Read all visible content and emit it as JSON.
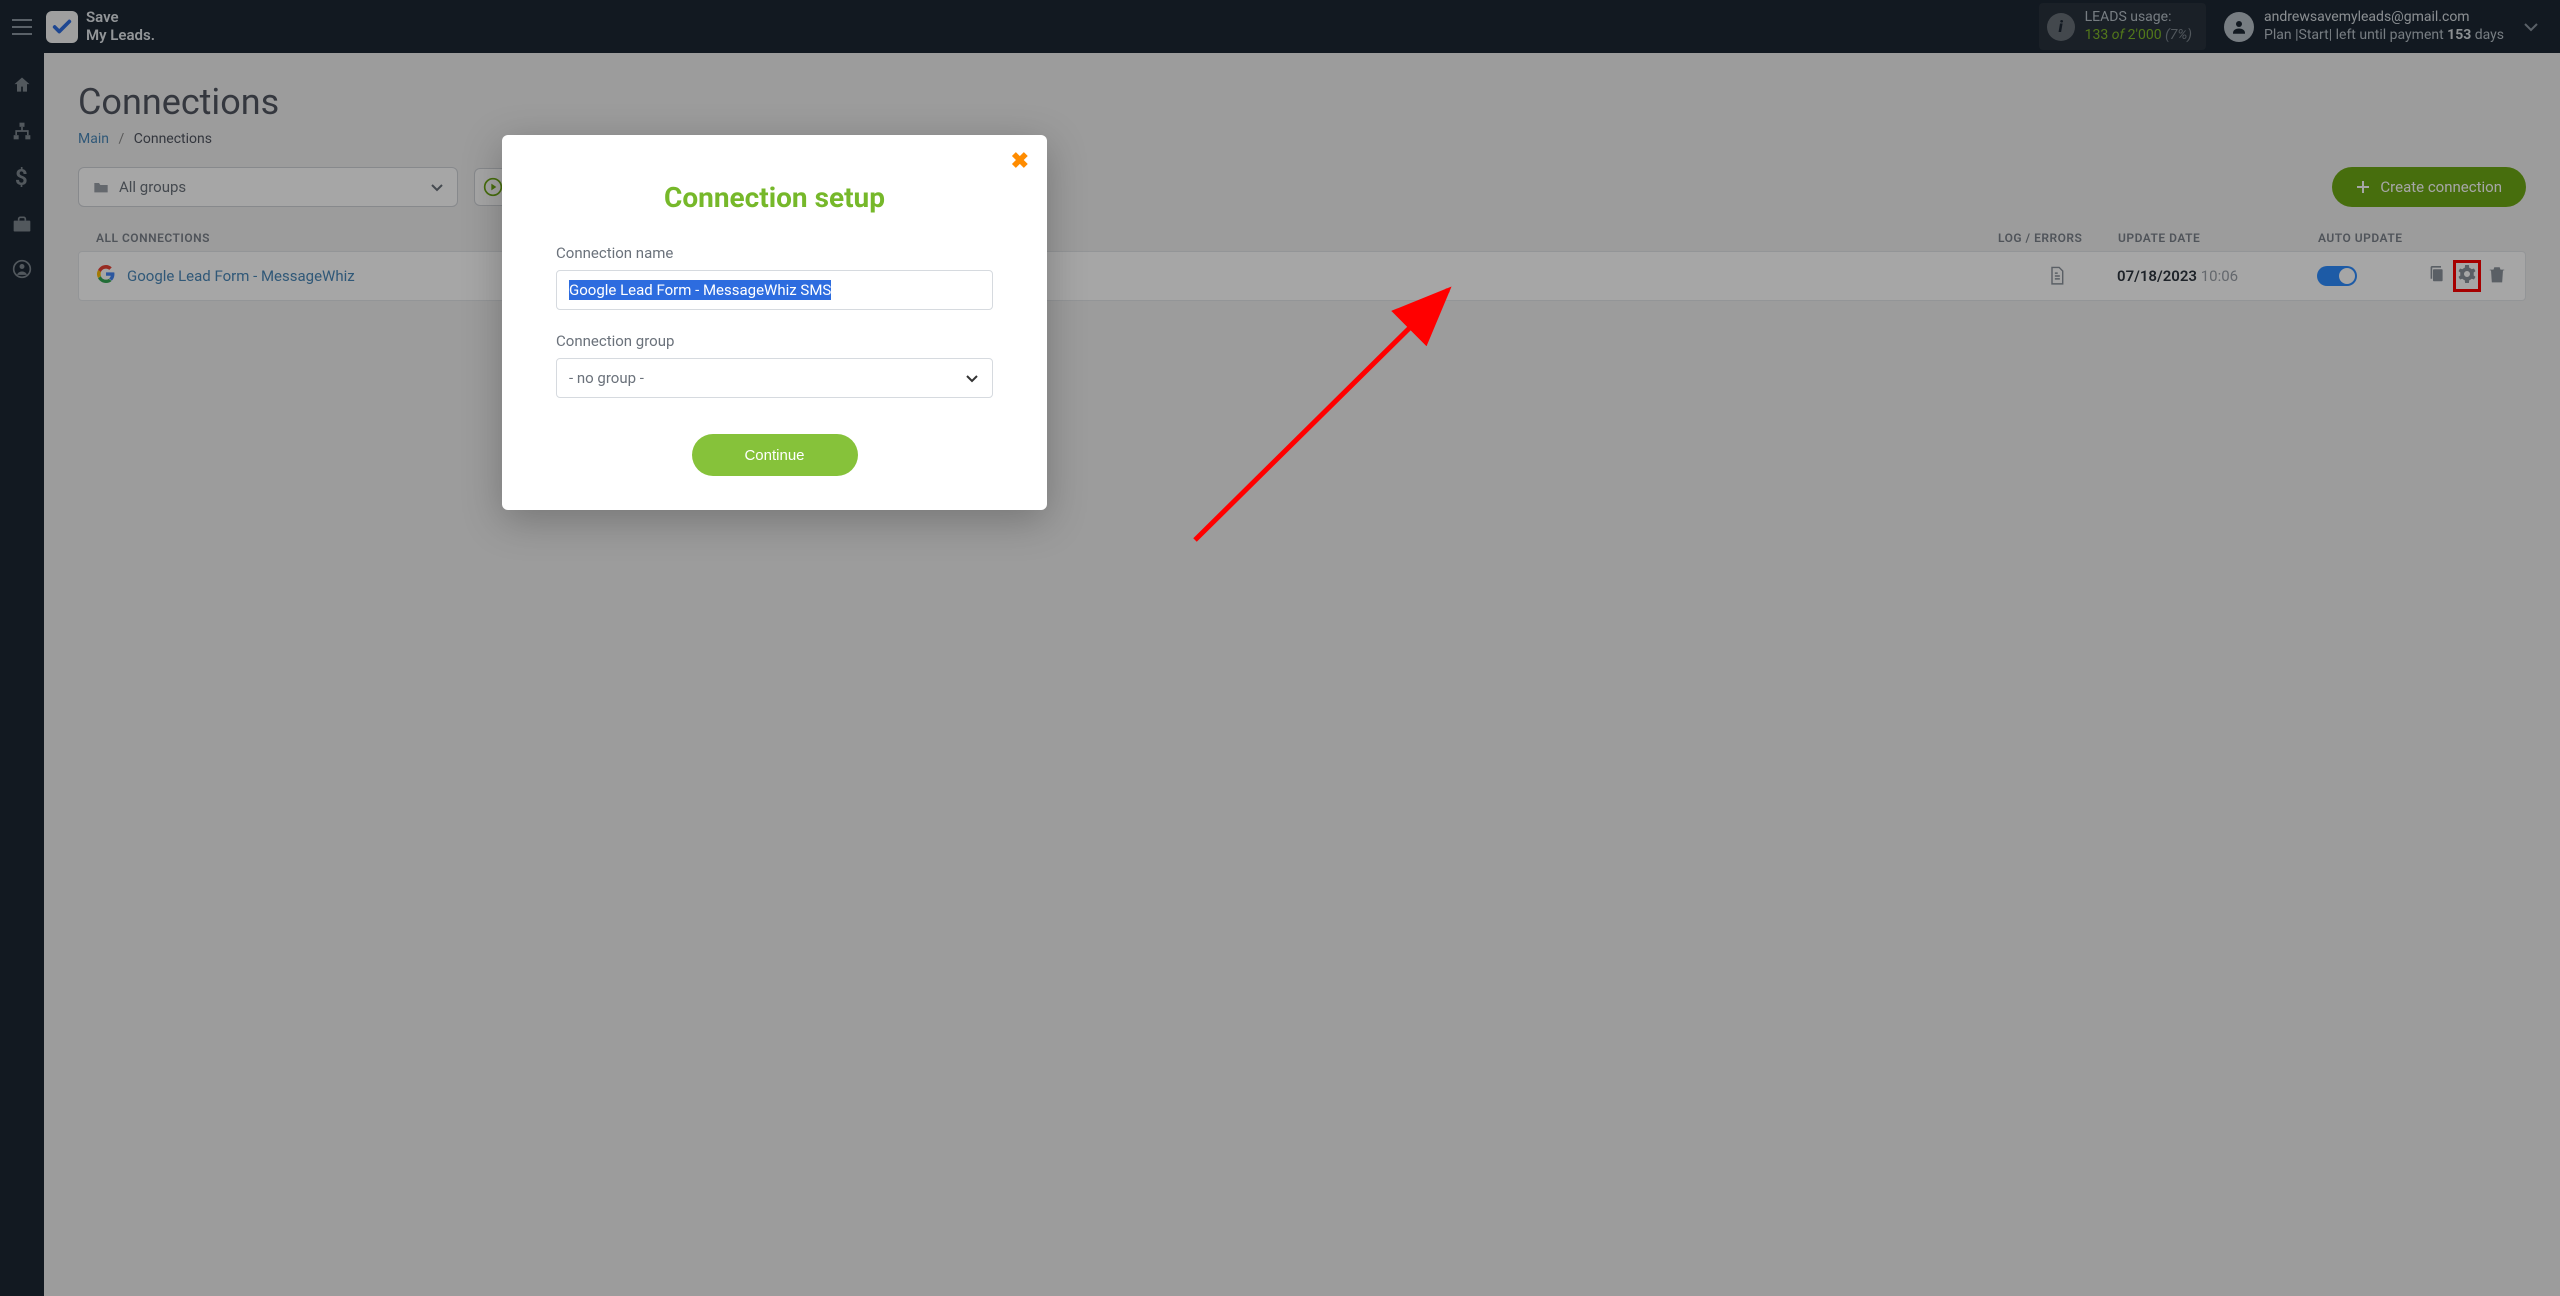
{
  "header": {
    "logo_line1": "Save",
    "logo_line2": "My Leads.",
    "usage_label": "LEADS usage:",
    "usage_current": "133",
    "usage_of": "of",
    "usage_total": "2'000",
    "usage_pct": "(7%)",
    "user_email": "andrewsavemyleads@gmail.com",
    "plan_prefix": "Plan |",
    "plan_name": "Start",
    "plan_mid": "| left until payment ",
    "plan_days": "153",
    "plan_suffix": " days"
  },
  "page": {
    "title": "Connections",
    "bc_main": "Main",
    "bc_current": "Connections",
    "group_filter": "All groups",
    "create_label": "Create connection"
  },
  "columns": {
    "name": "ALL CONNECTIONS",
    "log": "LOG / ERRORS",
    "date": "UPDATE DATE",
    "auto": "AUTO UPDATE"
  },
  "row": {
    "name": "Google Lead Form - MessageWhiz",
    "date": "07/18/2023",
    "time": "10:06"
  },
  "modal": {
    "title": "Connection setup",
    "name_label": "Connection name",
    "name_value": "Google Lead Form - MessageWhiz SMS",
    "group_label": "Connection group",
    "group_value": "- no group -",
    "continue": "Continue"
  }
}
